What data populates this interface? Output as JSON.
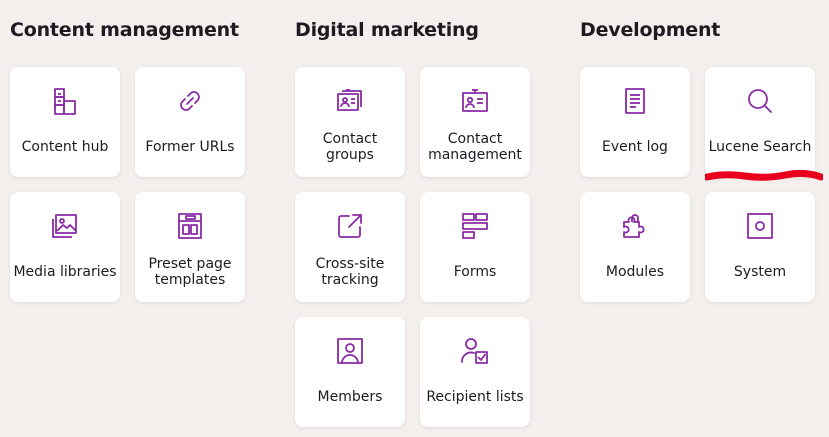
{
  "sections": [
    {
      "title": "Content management",
      "tiles": [
        {
          "label": "Content hub",
          "icon": "content-hub-icon"
        },
        {
          "label": "Former URLs",
          "icon": "link-icon"
        },
        {
          "label": "Media libraries",
          "icon": "media-library-icon"
        },
        {
          "label": "Preset page templates",
          "icon": "page-template-icon"
        }
      ]
    },
    {
      "title": "Digital marketing",
      "tiles": [
        {
          "label": "Contact groups",
          "icon": "contact-groups-icon"
        },
        {
          "label": "Contact management",
          "icon": "contact-card-icon"
        },
        {
          "label": "Cross-site tracking",
          "icon": "external-link-icon"
        },
        {
          "label": "Forms",
          "icon": "form-layout-icon"
        },
        {
          "label": "Members",
          "icon": "member-icon"
        },
        {
          "label": "Recipient lists",
          "icon": "user-checklist-icon"
        }
      ]
    },
    {
      "title": "Development",
      "tiles": [
        {
          "label": "Event log",
          "icon": "document-list-icon"
        },
        {
          "label": "Lucene Search",
          "icon": "search-icon"
        },
        {
          "label": "Modules",
          "icon": "puzzle-icon"
        },
        {
          "label": "System",
          "icon": "system-box-icon"
        }
      ]
    }
  ],
  "colors": {
    "accent": "#8a2ba6",
    "background": "#f3efed",
    "tile": "#ffffff",
    "annotation": "#e8001c"
  }
}
